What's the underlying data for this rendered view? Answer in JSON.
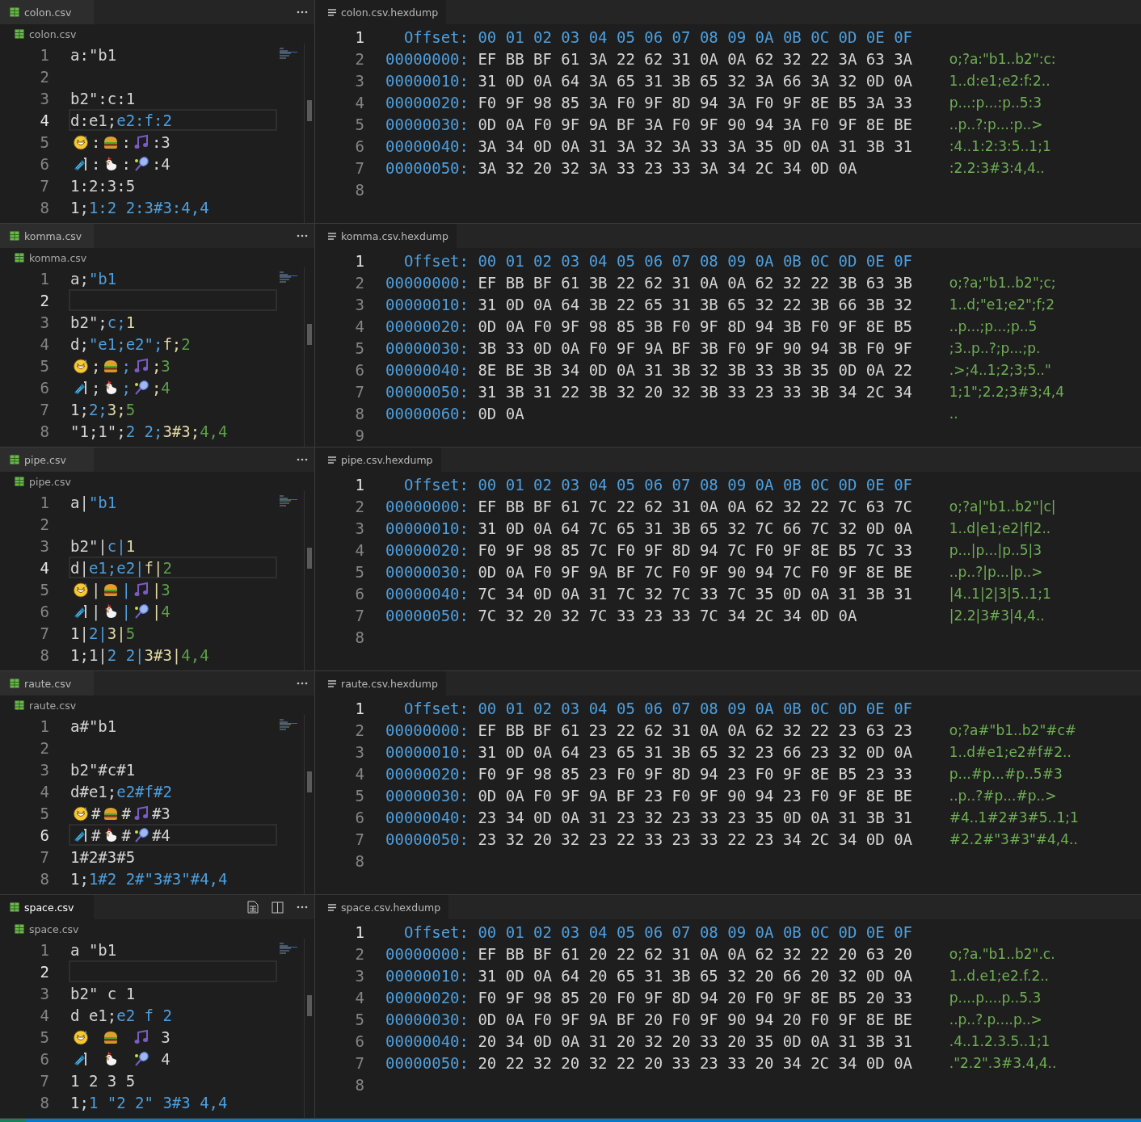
{
  "panes": [
    {
      "editor": {
        "tab": {
          "label": "colon.csv",
          "active": false
        },
        "breadcrumb": "colon.csv",
        "lines": [
          {
            "number": "1",
            "current": false,
            "segments": [
              {
                "kind": "text",
                "text": "a:\"b1",
                "color": "#d4d4d4"
              }
            ]
          },
          {
            "number": "2",
            "current": false
          },
          {
            "number": "3",
            "current": false,
            "segments": [
              {
                "kind": "text",
                "text": "b2\":c:1",
                "color": "#d4d4d4"
              }
            ]
          },
          {
            "number": "4",
            "current": true,
            "segments": [
              {
                "kind": "text",
                "text": "d:e1;",
                "color": "#d4d4d4"
              },
              {
                "kind": "text",
                "text": "e2:f:2",
                "color": "#4e9fde"
              }
            ]
          },
          {
            "number": "5",
            "current": false,
            "segments": [
              {
                "kind": "emoji"
              },
              {
                "kind": "text",
                "text": ":",
                "color": "#d4d4d4"
              },
              {
                "kind": "emoji"
              },
              {
                "kind": "text",
                "text": ":",
                "color": "#d4d4d4"
              },
              {
                "kind": "emoji"
              },
              {
                "kind": "text",
                "text": ":3",
                "color": "#d4d4d4"
              }
            ]
          },
          {
            "number": "6",
            "current": false,
            "segments": [
              {
                "kind": "emoji"
              },
              {
                "kind": "text",
                "text": ":",
                "color": "#d4d4d4"
              },
              {
                "kind": "emoji"
              },
              {
                "kind": "text",
                "text": ":",
                "color": "#d4d4d4"
              },
              {
                "kind": "emoji"
              },
              {
                "kind": "text",
                "text": ":4",
                "color": "#d4d4d4"
              }
            ]
          },
          {
            "number": "7",
            "current": false,
            "segments": [
              {
                "kind": "text",
                "text": "1:2:3:5",
                "color": "#d4d4d4"
              }
            ]
          },
          {
            "number": "8",
            "current": false,
            "segments": [
              {
                "kind": "text",
                "text": "1;",
                "color": "#d4d4d4"
              },
              {
                "kind": "text",
                "text": "1:2 2:3#3:4,4",
                "color": "#4e9fde"
              }
            ]
          }
        ]
      },
      "hexdump": {
        "tab": {
          "label": "colon.csv.hexdump"
        },
        "lines": [
          {
            "kind": "header",
            "number": "1",
            "current": true,
            "label": "Offset:",
            "columns": "00 01 02 03 04 05 06 07 08 09 0A 0B 0C 0D 0E 0F"
          },
          {
            "kind": "row",
            "number": "2",
            "current": false,
            "offset": "00000000:",
            "bytes": "EF BB BF 61 3A 22 62 31 0A 0A 62 32 22 3A 63 3A",
            "ascii": "o;?a:\"b1..b2\":c:"
          },
          {
            "kind": "row",
            "number": "3",
            "current": false,
            "offset": "00000010:",
            "bytes": "31 0D 0A 64 3A 65 31 3B 65 32 3A 66 3A 32 0D 0A",
            "ascii": "1..d:e1;e2:f:2.."
          },
          {
            "kind": "row",
            "number": "4",
            "current": false,
            "offset": "00000020:",
            "bytes": "F0 9F 98 85 3A F0 9F 8D 94 3A F0 9F 8E B5 3A 33",
            "ascii": "p...:p...:p..5:3"
          },
          {
            "kind": "row",
            "number": "5",
            "current": false,
            "offset": "00000030:",
            "bytes": "0D 0A F0 9F 9A BF 3A F0 9F 90 94 3A F0 9F 8E BE",
            "ascii": "..p..?:p...:p..>"
          },
          {
            "kind": "row",
            "number": "6",
            "current": false,
            "offset": "00000040:",
            "bytes": "3A 34 0D 0A 31 3A 32 3A 33 3A 35 0D 0A 31 3B 31",
            "ascii": ":4..1:2:3:5..1;1"
          },
          {
            "kind": "row",
            "number": "7",
            "current": false,
            "offset": "00000050:",
            "bytes": "3A 32 20 32 3A 33 23 33 3A 34 2C 34 0D 0A",
            "ascii": ":2.2:3#3:4,4.."
          },
          {
            "kind": "empty",
            "number": "8",
            "current": false
          }
        ]
      }
    },
    {
      "editor": {
        "tab": {
          "label": "komma.csv",
          "active": false
        },
        "breadcrumb": "komma.csv",
        "lines": [
          {
            "number": "1",
            "current": false,
            "segments": [
              {
                "kind": "text",
                "text": "a;",
                "color": "#d4d4d4"
              },
              {
                "kind": "text",
                "text": "\"b1",
                "color": "#4e9fde"
              }
            ]
          },
          {
            "number": "2",
            "current": true
          },
          {
            "number": "3",
            "current": false,
            "segments": [
              {
                "kind": "text",
                "text": "b2\";",
                "color": "#d4d4d4"
              },
              {
                "kind": "text",
                "text": "c;",
                "color": "#4e9fde"
              },
              {
                "kind": "text",
                "text": "1",
                "color": "#e2d9a6"
              }
            ]
          },
          {
            "number": "4",
            "current": false,
            "segments": [
              {
                "kind": "text",
                "text": "d;",
                "color": "#d4d4d4"
              },
              {
                "kind": "text",
                "text": "\"e1;e2\";",
                "color": "#4e9fde"
              },
              {
                "kind": "text",
                "text": "f;",
                "color": "#e2d9a6"
              },
              {
                "kind": "text",
                "text": "2",
                "color": "#5e9e4a"
              }
            ]
          },
          {
            "number": "5",
            "current": false,
            "segments": [
              {
                "kind": "emoji"
              },
              {
                "kind": "text",
                "text": ";",
                "color": "#d4d4d4"
              },
              {
                "kind": "emoji"
              },
              {
                "kind": "text",
                "text": ";",
                "color": "#4e9fde"
              },
              {
                "kind": "emoji"
              },
              {
                "kind": "text",
                "text": ";",
                "color": "#e2d9a6"
              },
              {
                "kind": "text",
                "text": "3",
                "color": "#5e9e4a"
              }
            ]
          },
          {
            "number": "6",
            "current": false,
            "segments": [
              {
                "kind": "emoji"
              },
              {
                "kind": "text",
                "text": ";",
                "color": "#d4d4d4"
              },
              {
                "kind": "emoji"
              },
              {
                "kind": "text",
                "text": ";",
                "color": "#4e9fde"
              },
              {
                "kind": "emoji"
              },
              {
                "kind": "text",
                "text": ";",
                "color": "#e2d9a6"
              },
              {
                "kind": "text",
                "text": "4",
                "color": "#5e9e4a"
              }
            ]
          },
          {
            "number": "7",
            "current": false,
            "segments": [
              {
                "kind": "text",
                "text": "1;",
                "color": "#d4d4d4"
              },
              {
                "kind": "text",
                "text": "2;",
                "color": "#4e9fde"
              },
              {
                "kind": "text",
                "text": "3;",
                "color": "#e2d9a6"
              },
              {
                "kind": "text",
                "text": "5",
                "color": "#5e9e4a"
              }
            ]
          },
          {
            "number": "8",
            "current": false,
            "segments": [
              {
                "kind": "text",
                "text": "\"1;1\";",
                "color": "#d4d4d4"
              },
              {
                "kind": "text",
                "text": "2 2;",
                "color": "#4e9fde"
              },
              {
                "kind": "text",
                "text": "3#3;",
                "color": "#e2d9a6"
              },
              {
                "kind": "text",
                "text": "4,4",
                "color": "#5e9e4a"
              }
            ]
          }
        ]
      },
      "hexdump": {
        "tab": {
          "label": "komma.csv.hexdump"
        },
        "lines": [
          {
            "kind": "header",
            "number": "1",
            "current": true,
            "label": "Offset:",
            "columns": "00 01 02 03 04 05 06 07 08 09 0A 0B 0C 0D 0E 0F"
          },
          {
            "kind": "row",
            "number": "2",
            "current": false,
            "offset": "00000000:",
            "bytes": "EF BB BF 61 3B 22 62 31 0A 0A 62 32 22 3B 63 3B",
            "ascii": "o;?a;\"b1..b2\";c;"
          },
          {
            "kind": "row",
            "number": "3",
            "current": false,
            "offset": "00000010:",
            "bytes": "31 0D 0A 64 3B 22 65 31 3B 65 32 22 3B 66 3B 32",
            "ascii": "1..d;\"e1;e2\";f;2"
          },
          {
            "kind": "row",
            "number": "4",
            "current": false,
            "offset": "00000020:",
            "bytes": "0D 0A F0 9F 98 85 3B F0 9F 8D 94 3B F0 9F 8E B5",
            "ascii": "..p...;p...;p..5"
          },
          {
            "kind": "row",
            "number": "5",
            "current": false,
            "offset": "00000030:",
            "bytes": "3B 33 0D 0A F0 9F 9A BF 3B F0 9F 90 94 3B F0 9F",
            "ascii": ";3..p..?;p...;p."
          },
          {
            "kind": "row",
            "number": "6",
            "current": false,
            "offset": "00000040:",
            "bytes": "8E BE 3B 34 0D 0A 31 3B 32 3B 33 3B 35 0D 0A 22",
            "ascii": ".>;4..1;2;3;5..\""
          },
          {
            "kind": "row",
            "number": "7",
            "current": false,
            "offset": "00000050:",
            "bytes": "31 3B 31 22 3B 32 20 32 3B 33 23 33 3B 34 2C 34",
            "ascii": "1;1\";2.2;3#3;4,4"
          },
          {
            "kind": "row",
            "number": "8",
            "current": false,
            "offset": "00000060:",
            "bytes": "0D 0A",
            "ascii": ".."
          },
          {
            "kind": "empty",
            "number": "9",
            "current": false
          }
        ]
      }
    },
    {
      "editor": {
        "tab": {
          "label": "pipe.csv",
          "active": false
        },
        "breadcrumb": "pipe.csv",
        "lines": [
          {
            "number": "1",
            "current": false,
            "segments": [
              {
                "kind": "text",
                "text": "a|",
                "color": "#d4d4d4"
              },
              {
                "kind": "text",
                "text": "\"b1",
                "color": "#4e9fde"
              }
            ]
          },
          {
            "number": "2",
            "current": false
          },
          {
            "number": "3",
            "current": false,
            "segments": [
              {
                "kind": "text",
                "text": "b2\"|",
                "color": "#d4d4d4"
              },
              {
                "kind": "text",
                "text": "c|",
                "color": "#4e9fde"
              },
              {
                "kind": "text",
                "text": "1",
                "color": "#e2d9a6"
              }
            ]
          },
          {
            "number": "4",
            "current": true,
            "segments": [
              {
                "kind": "text",
                "text": "d|",
                "color": "#d4d4d4"
              },
              {
                "kind": "text",
                "text": "e1;e2|",
                "color": "#4e9fde"
              },
              {
                "kind": "text",
                "text": "f|",
                "color": "#e2d9a6"
              },
              {
                "kind": "text",
                "text": "2",
                "color": "#5e9e4a"
              }
            ]
          },
          {
            "number": "5",
            "current": false,
            "segments": [
              {
                "kind": "emoji"
              },
              {
                "kind": "text",
                "text": "|",
                "color": "#d4d4d4"
              },
              {
                "kind": "emoji"
              },
              {
                "kind": "text",
                "text": "|",
                "color": "#4e9fde"
              },
              {
                "kind": "emoji"
              },
              {
                "kind": "text",
                "text": "|",
                "color": "#e2d9a6"
              },
              {
                "kind": "text",
                "text": "3",
                "color": "#5e9e4a"
              }
            ]
          },
          {
            "number": "6",
            "current": false,
            "segments": [
              {
                "kind": "emoji"
              },
              {
                "kind": "text",
                "text": "|",
                "color": "#d4d4d4"
              },
              {
                "kind": "emoji"
              },
              {
                "kind": "text",
                "text": "|",
                "color": "#4e9fde"
              },
              {
                "kind": "emoji"
              },
              {
                "kind": "text",
                "text": "|",
                "color": "#e2d9a6"
              },
              {
                "kind": "text",
                "text": "4",
                "color": "#5e9e4a"
              }
            ]
          },
          {
            "number": "7",
            "current": false,
            "segments": [
              {
                "kind": "text",
                "text": "1|",
                "color": "#d4d4d4"
              },
              {
                "kind": "text",
                "text": "2|",
                "color": "#4e9fde"
              },
              {
                "kind": "text",
                "text": "3|",
                "color": "#e2d9a6"
              },
              {
                "kind": "text",
                "text": "5",
                "color": "#5e9e4a"
              }
            ]
          },
          {
            "number": "8",
            "current": false,
            "segments": [
              {
                "kind": "text",
                "text": "1;1|",
                "color": "#d4d4d4"
              },
              {
                "kind": "text",
                "text": "2 2|",
                "color": "#4e9fde"
              },
              {
                "kind": "text",
                "text": "3#3|",
                "color": "#e2d9a6"
              },
              {
                "kind": "text",
                "text": "4,4",
                "color": "#5e9e4a"
              }
            ]
          }
        ]
      },
      "hexdump": {
        "tab": {
          "label": "pipe.csv.hexdump"
        },
        "lines": [
          {
            "kind": "header",
            "number": "1",
            "current": true,
            "label": "Offset:",
            "columns": "00 01 02 03 04 05 06 07 08 09 0A 0B 0C 0D 0E 0F"
          },
          {
            "kind": "row",
            "number": "2",
            "current": false,
            "offset": "00000000:",
            "bytes": "EF BB BF 61 7C 22 62 31 0A 0A 62 32 22 7C 63 7C",
            "ascii": "o;?a|\"b1..b2\"|c|"
          },
          {
            "kind": "row",
            "number": "3",
            "current": false,
            "offset": "00000010:",
            "bytes": "31 0D 0A 64 7C 65 31 3B 65 32 7C 66 7C 32 0D 0A",
            "ascii": "1..d|e1;e2|f|2.."
          },
          {
            "kind": "row",
            "number": "4",
            "current": false,
            "offset": "00000020:",
            "bytes": "F0 9F 98 85 7C F0 9F 8D 94 7C F0 9F 8E B5 7C 33",
            "ascii": "p...|p...|p..5|3"
          },
          {
            "kind": "row",
            "number": "5",
            "current": false,
            "offset": "00000030:",
            "bytes": "0D 0A F0 9F 9A BF 7C F0 9F 90 94 7C F0 9F 8E BE",
            "ascii": "..p..?|p...|p..>"
          },
          {
            "kind": "row",
            "number": "6",
            "current": false,
            "offset": "00000040:",
            "bytes": "7C 34 0D 0A 31 7C 32 7C 33 7C 35 0D 0A 31 3B 31",
            "ascii": "|4..1|2|3|5..1;1"
          },
          {
            "kind": "row",
            "number": "7",
            "current": false,
            "offset": "00000050:",
            "bytes": "7C 32 20 32 7C 33 23 33 7C 34 2C 34 0D 0A",
            "ascii": "|2.2|3#3|4,4.."
          },
          {
            "kind": "empty",
            "number": "8",
            "current": false
          }
        ]
      }
    },
    {
      "editor": {
        "tab": {
          "label": "raute.csv",
          "active": false
        },
        "breadcrumb": "raute.csv",
        "lines": [
          {
            "number": "1",
            "current": false,
            "segments": [
              {
                "kind": "text",
                "text": "a#\"b1",
                "color": "#d4d4d4"
              }
            ]
          },
          {
            "number": "2",
            "current": false
          },
          {
            "number": "3",
            "current": false,
            "segments": [
              {
                "kind": "text",
                "text": "b2\"#c#1",
                "color": "#d4d4d4"
              }
            ]
          },
          {
            "number": "4",
            "current": false,
            "segments": [
              {
                "kind": "text",
                "text": "d#e1;",
                "color": "#d4d4d4"
              },
              {
                "kind": "text",
                "text": "e2#f#2",
                "color": "#4e9fde"
              }
            ]
          },
          {
            "number": "5",
            "current": false,
            "segments": [
              {
                "kind": "emoji"
              },
              {
                "kind": "text",
                "text": "#",
                "color": "#d4d4d4"
              },
              {
                "kind": "emoji"
              },
              {
                "kind": "text",
                "text": "#",
                "color": "#d4d4d4"
              },
              {
                "kind": "emoji"
              },
              {
                "kind": "text",
                "text": "#3",
                "color": "#d4d4d4"
              }
            ]
          },
          {
            "number": "6",
            "current": true,
            "segments": [
              {
                "kind": "emoji"
              },
              {
                "kind": "text",
                "text": "#",
                "color": "#d4d4d4"
              },
              {
                "kind": "emoji"
              },
              {
                "kind": "text",
                "text": "#",
                "color": "#d4d4d4"
              },
              {
                "kind": "emoji"
              },
              {
                "kind": "text",
                "text": "#4",
                "color": "#d4d4d4"
              }
            ]
          },
          {
            "number": "7",
            "current": false,
            "segments": [
              {
                "kind": "text",
                "text": "1#2#3#5",
                "color": "#d4d4d4"
              }
            ]
          },
          {
            "number": "8",
            "current": false,
            "segments": [
              {
                "kind": "text",
                "text": "1;",
                "color": "#d4d4d4"
              },
              {
                "kind": "text",
                "text": "1#2 2#\"3#3\"#4,4",
                "color": "#4e9fde"
              }
            ]
          }
        ]
      },
      "hexdump": {
        "tab": {
          "label": "raute.csv.hexdump"
        },
        "lines": [
          {
            "kind": "header",
            "number": "1",
            "current": true,
            "label": "Offset:",
            "columns": "00 01 02 03 04 05 06 07 08 09 0A 0B 0C 0D 0E 0F"
          },
          {
            "kind": "row",
            "number": "2",
            "current": false,
            "offset": "00000000:",
            "bytes": "EF BB BF 61 23 22 62 31 0A 0A 62 32 22 23 63 23",
            "ascii": "o;?a#\"b1..b2\"#c#"
          },
          {
            "kind": "row",
            "number": "3",
            "current": false,
            "offset": "00000010:",
            "bytes": "31 0D 0A 64 23 65 31 3B 65 32 23 66 23 32 0D 0A",
            "ascii": "1..d#e1;e2#f#2.."
          },
          {
            "kind": "row",
            "number": "4",
            "current": false,
            "offset": "00000020:",
            "bytes": "F0 9F 98 85 23 F0 9F 8D 94 23 F0 9F 8E B5 23 33",
            "ascii": "p...#p...#p..5#3"
          },
          {
            "kind": "row",
            "number": "5",
            "current": false,
            "offset": "00000030:",
            "bytes": "0D 0A F0 9F 9A BF 23 F0 9F 90 94 23 F0 9F 8E BE",
            "ascii": "..p..?#p...#p..>"
          },
          {
            "kind": "row",
            "number": "6",
            "current": false,
            "offset": "00000040:",
            "bytes": "23 34 0D 0A 31 23 32 23 33 23 35 0D 0A 31 3B 31",
            "ascii": "#4..1#2#3#5..1;1"
          },
          {
            "kind": "row",
            "number": "7",
            "current": false,
            "offset": "00000050:",
            "bytes": "23 32 20 32 23 22 33 23 33 22 23 34 2C 34 0D 0A",
            "ascii": "#2.2#\"3#3\"#4,4.."
          },
          {
            "kind": "empty",
            "number": "8",
            "current": false
          }
        ]
      }
    },
    {
      "editor": {
        "tab": {
          "label": "space.csv",
          "active": true
        },
        "breadcrumb": "space.csv",
        "lines": [
          {
            "number": "1",
            "current": false,
            "segments": [
              {
                "kind": "text",
                "text": "a \"b1",
                "color": "#d4d4d4"
              }
            ]
          },
          {
            "number": "2",
            "current": true
          },
          {
            "number": "3",
            "current": false,
            "segments": [
              {
                "kind": "text",
                "text": "b2\" c 1",
                "color": "#d4d4d4"
              }
            ]
          },
          {
            "number": "4",
            "current": false,
            "segments": [
              {
                "kind": "text",
                "text": "d e1;",
                "color": "#d4d4d4"
              },
              {
                "kind": "text",
                "text": "e2 f 2",
                "color": "#4e9fde"
              }
            ]
          },
          {
            "number": "5",
            "current": false,
            "segments": [
              {
                "kind": "emoji"
              },
              {
                "kind": "space"
              },
              {
                "kind": "emoji"
              },
              {
                "kind": "space"
              },
              {
                "kind": "emoji"
              },
              {
                "kind": "text",
                "text": " 3",
                "color": "#d4d4d4"
              }
            ]
          },
          {
            "number": "6",
            "current": false,
            "segments": [
              {
                "kind": "emoji"
              },
              {
                "kind": "space"
              },
              {
                "kind": "emoji"
              },
              {
                "kind": "space"
              },
              {
                "kind": "emoji"
              },
              {
                "kind": "text",
                "text": " 4",
                "color": "#d4d4d4"
              }
            ]
          },
          {
            "number": "7",
            "current": false,
            "segments": [
              {
                "kind": "text",
                "text": "1 2 3 5",
                "color": "#d4d4d4"
              }
            ]
          },
          {
            "number": "8",
            "current": false,
            "segments": [
              {
                "kind": "text",
                "text": "1;",
                "color": "#d4d4d4"
              },
              {
                "kind": "text",
                "text": "1 \"2 2\" 3#3 4,4",
                "color": "#4e9fde"
              }
            ]
          }
        ]
      },
      "hexdump": {
        "tab": {
          "label": "space.csv.hexdump"
        },
        "lines": [
          {
            "kind": "header",
            "number": "1",
            "current": true,
            "label": "Offset:",
            "columns": "00 01 02 03 04 05 06 07 08 09 0A 0B 0C 0D 0E 0F"
          },
          {
            "kind": "row",
            "number": "2",
            "current": false,
            "offset": "00000000:",
            "bytes": "EF BB BF 61 20 22 62 31 0A 0A 62 32 22 20 63 20",
            "ascii": "o;?a.\"b1..b2\".c."
          },
          {
            "kind": "row",
            "number": "3",
            "current": false,
            "offset": "00000010:",
            "bytes": "31 0D 0A 64 20 65 31 3B 65 32 20 66 20 32 0D 0A",
            "ascii": "1..d.e1;e2.f.2.."
          },
          {
            "kind": "row",
            "number": "4",
            "current": false,
            "offset": "00000020:",
            "bytes": "F0 9F 98 85 20 F0 9F 8D 94 20 F0 9F 8E B5 20 33",
            "ascii": "p....p....p..5.3"
          },
          {
            "kind": "row",
            "number": "5",
            "current": false,
            "offset": "00000030:",
            "bytes": "0D 0A F0 9F 9A BF 20 F0 9F 90 94 20 F0 9F 8E BE",
            "ascii": "..p..?.p....p..>"
          },
          {
            "kind": "row",
            "number": "6",
            "current": false,
            "offset": "00000040:",
            "bytes": "20 34 0D 0A 31 20 32 20 33 20 35 0D 0A 31 3B 31",
            "ascii": ".4..1.2.3.5..1;1"
          },
          {
            "kind": "row",
            "number": "7",
            "current": false,
            "offset": "00000050:",
            "bytes": "20 22 32 20 32 22 20 33 23 33 20 34 2C 34 0D 0A",
            "ascii": ".\"2.2\".3#3.4,4.."
          },
          {
            "kind": "empty",
            "number": "8",
            "current": false
          }
        ]
      }
    }
  ]
}
